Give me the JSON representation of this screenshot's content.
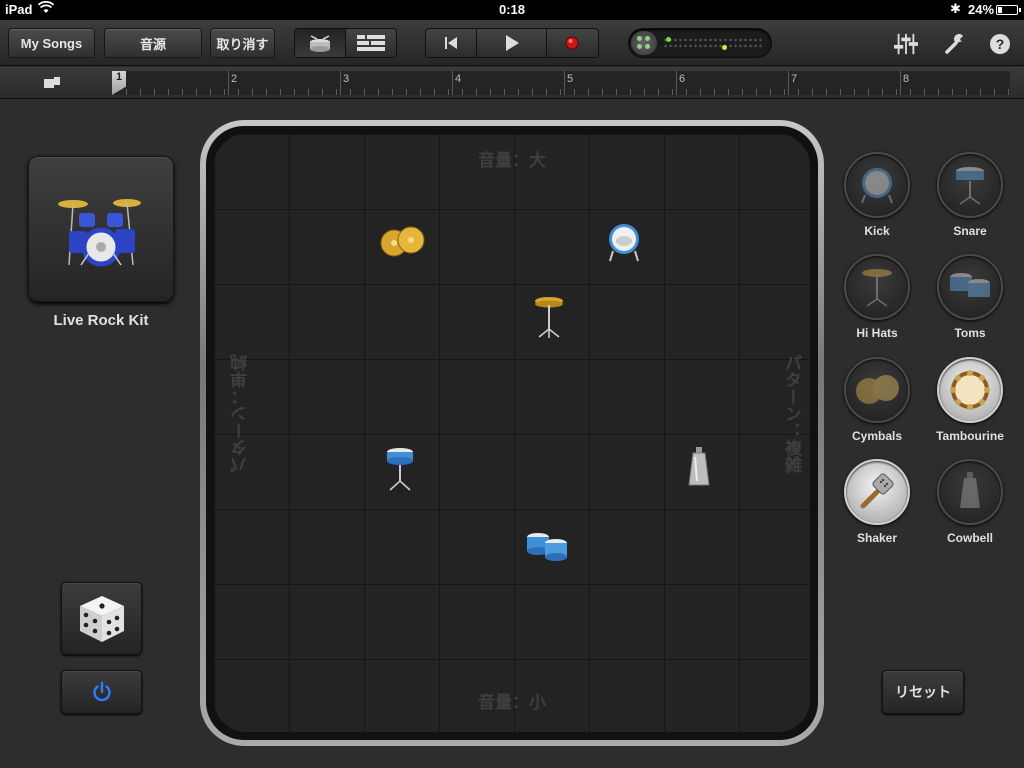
{
  "status_bar": {
    "carrier": "iPad",
    "time": "0:18",
    "battery_text": "24%",
    "battery_level": 0.24
  },
  "toolbar": {
    "my_songs_label": "My Songs",
    "instruments_label": "音源",
    "undo_label": "取り消す",
    "view_mode_selected": "instrument",
    "icons": [
      "drum-view-icon",
      "tracks-view-icon",
      "rewind-icon",
      "play-icon",
      "record-icon",
      "mixer-icon",
      "wrench-icon",
      "help-icon"
    ]
  },
  "ruler": {
    "bars": [
      "1",
      "2",
      "3",
      "4",
      "5",
      "6",
      "7",
      "8"
    ]
  },
  "kit": {
    "name": "Live Rock Kit"
  },
  "pad": {
    "label_top": "音量：大",
    "label_bottom": "音量：小",
    "label_left": "パターン：単純",
    "label_right": "パターン：複雑"
  },
  "instruments": [
    {
      "name": "Kick",
      "active": false,
      "icon": "kick-drum-icon"
    },
    {
      "name": "Snare",
      "active": false,
      "icon": "snare-drum-icon"
    },
    {
      "name": "Hi Hats",
      "active": false,
      "icon": "hihat-icon"
    },
    {
      "name": "Toms",
      "active": false,
      "icon": "toms-icon"
    },
    {
      "name": "Cymbals",
      "active": false,
      "icon": "cymbals-icon"
    },
    {
      "name": "Tambourine",
      "active": true,
      "icon": "tambourine-icon"
    },
    {
      "name": "Shaker",
      "active": true,
      "icon": "shaker-icon"
    },
    {
      "name": "Cowbell",
      "active": false,
      "icon": "cowbell-icon"
    }
  ],
  "reset_label": "リセット",
  "colors": {
    "accent_blue": "#2a7fff",
    "record_red": "#d01818",
    "cymbal_gold": "#d9a52a",
    "drum_blue": "#3d8fd8"
  }
}
